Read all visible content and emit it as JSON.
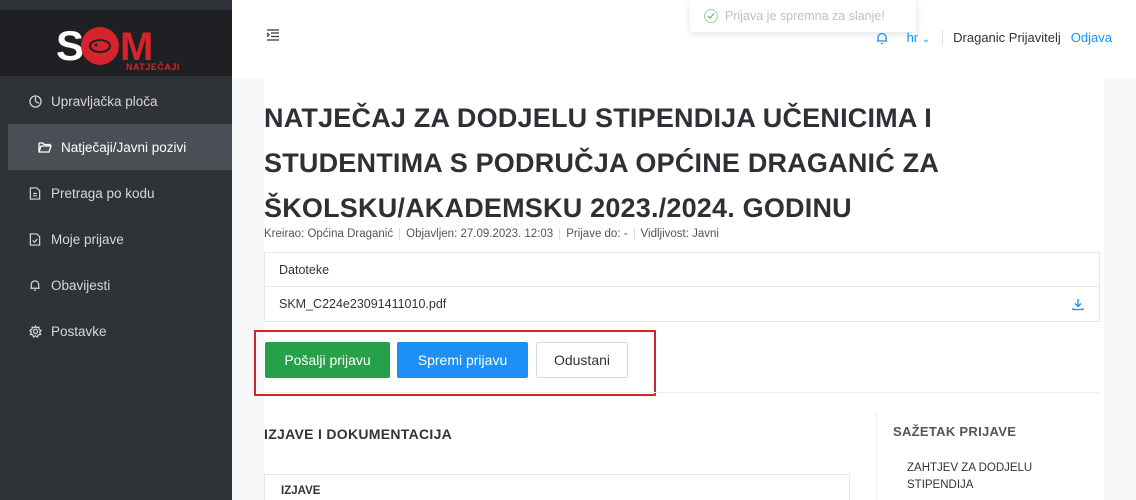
{
  "brand": {
    "logo_text": "SOM",
    "logo_subtext": "NATJEČAJI",
    "accent_color": "#d6232c"
  },
  "sidebar": {
    "items": [
      {
        "label": "Upravljačka ploča",
        "icon": "dashboard-icon"
      },
      {
        "label": "Natječaji/Javni pozivi",
        "icon": "folder-open-icon",
        "active": true
      },
      {
        "label": "Pretraga po kodu",
        "icon": "document-icon"
      },
      {
        "label": "Moje prijave",
        "icon": "document-check-icon"
      },
      {
        "label": "Obavijesti",
        "icon": "bell-icon"
      },
      {
        "label": "Postavke",
        "icon": "gear-icon"
      }
    ]
  },
  "topbar": {
    "toast": "Prijava je spremna za slanje!",
    "language": "hr",
    "user_name": "Draganic Prijavitelj",
    "logout": "Odjava"
  },
  "page": {
    "title": "NATJEČAJ ZA DODJELU STIPENDIJA UČENICIMA I STUDENTIMA S PODRUČJA OPĆINE DRAGANIĆ ZA ŠKOLSKU/AKADEMSKU 2023./2024. GODINU",
    "meta": {
      "created": "Kreirao: Općina Draganić",
      "published": "Objavljen: 27.09.2023. 12:03",
      "deadline": "Prijave do: -",
      "visibility": "Vidljivost: Javni"
    },
    "files": {
      "header": "Datoteke",
      "items": [
        "SKM_C224e23091411010.pdf"
      ]
    },
    "actions": {
      "send": "Pošalji prijavu",
      "save": "Spremi prijavu",
      "cancel": "Odustani"
    },
    "section_title": "IZJAVE I DOKUMENTACIJA",
    "izjave_label": "IZJAVE",
    "summary": {
      "title": "SAŽETAK PRIJAVE",
      "items": [
        "ZAHTJEV ZA DODJELU STIPENDIJA"
      ]
    }
  }
}
